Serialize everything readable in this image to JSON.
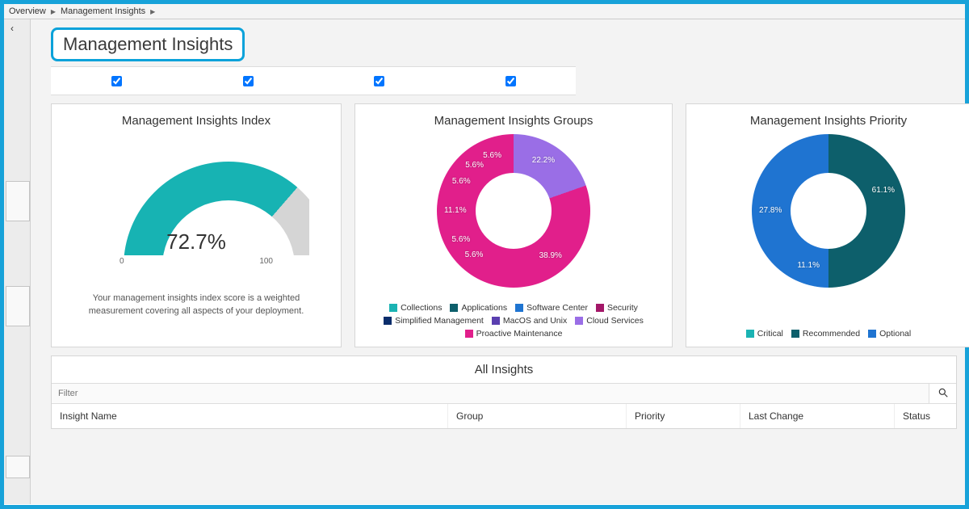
{
  "breadcrumb": [
    "Overview",
    "Management Insights"
  ],
  "page_title": "Management Insights",
  "checks": [
    true,
    true,
    true,
    true
  ],
  "cards": {
    "index": {
      "title": "Management Insights Index",
      "value_label": "72.7%",
      "min": "0",
      "max": "100",
      "desc": "Your management insights index score is a weighted measurement covering all aspects of your deployment."
    },
    "groups": {
      "title": "Management Insights Groups"
    },
    "priority": {
      "title": "Management Insights Priority"
    }
  },
  "table": {
    "title": "All Insights",
    "filter_placeholder": "Filter",
    "columns": [
      "Insight Name",
      "Group",
      "Priority",
      "Last Change",
      "Status"
    ]
  },
  "chart_data": [
    {
      "type": "gauge",
      "title": "Management Insights Index",
      "value": 72.7,
      "min": 0,
      "max": 100
    },
    {
      "type": "pie",
      "title": "Management Insights Groups",
      "series": [
        {
          "name": "Collections",
          "value": 5.6,
          "color": "#1bb3b3"
        },
        {
          "name": "Applications",
          "value": 5.6,
          "color": "#0d5f6b"
        },
        {
          "name": "Software Center",
          "value": 11.1,
          "color": "#1f74d1"
        },
        {
          "name": "Security",
          "value": 5.6,
          "color": "#a31768"
        },
        {
          "name": "Simplified Management",
          "value": 5.6,
          "color": "#0b2d6b"
        },
        {
          "name": "MacOS and Unix",
          "value": 5.6,
          "color": "#5a3fb0"
        },
        {
          "name": "Cloud Services",
          "value": 22.2,
          "color": "#9a6ee6"
        },
        {
          "name": "Proactive Maintenance",
          "value": 38.9,
          "color": "#e11f8b"
        }
      ]
    },
    {
      "type": "pie",
      "title": "Management Insights Priority",
      "series": [
        {
          "name": "Critical",
          "value": 27.8,
          "color": "#1bb3b3"
        },
        {
          "name": "Recommended",
          "value": 61.1,
          "color": "#0d5f6b"
        },
        {
          "name": "Optional",
          "value": 11.1,
          "color": "#1f74d1"
        }
      ]
    }
  ]
}
